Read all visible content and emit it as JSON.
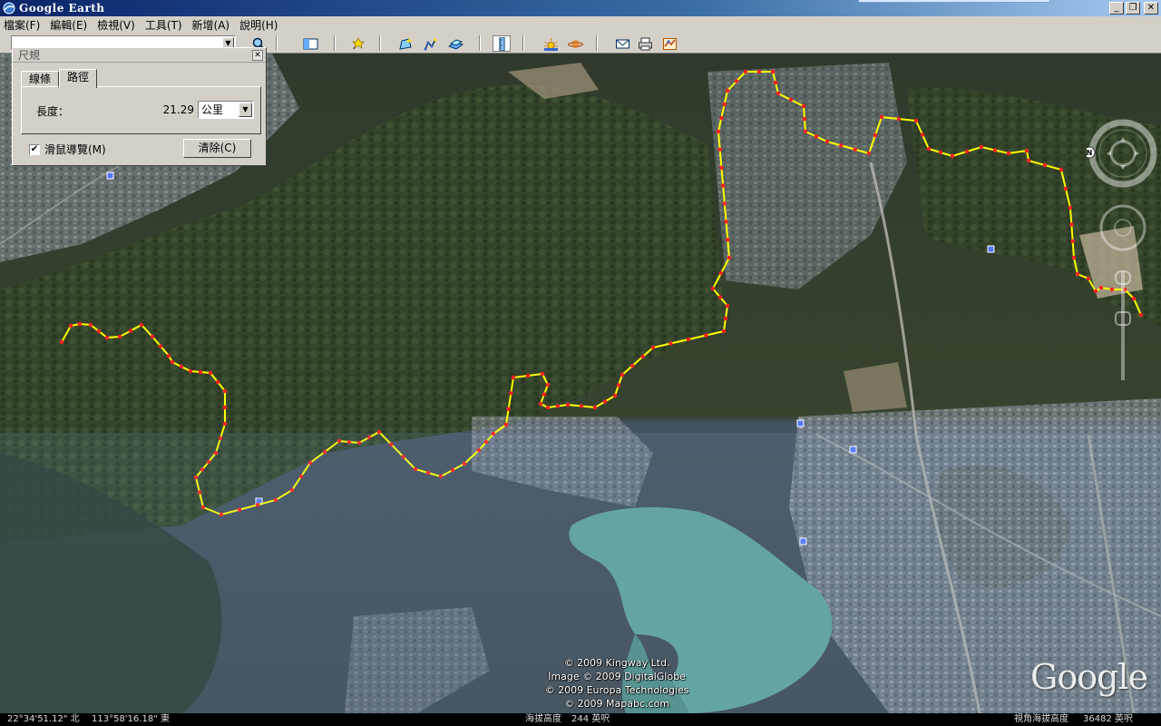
{
  "window": {
    "title": "Google Earth",
    "btn_minimize": "_",
    "btn_restore": "❐",
    "btn_close": "✕"
  },
  "menu": [
    "檔案(F)",
    "編輯(E)",
    "檢視(V)",
    "工具(T)",
    "新增(A)",
    "說明(H)"
  ],
  "toolbar": {
    "search_value": "",
    "icons": [
      "sidebar-toggle-icon",
      "placemark-icon",
      "polygon-icon",
      "path-icon",
      "image-overlay-icon",
      "ruler-icon",
      "sun-icon",
      "planet-icon",
      "email-icon",
      "print-icon",
      "maps-icon"
    ]
  },
  "ruler_dialog": {
    "title": "尺規",
    "tabs": [
      "線條",
      "路徑"
    ],
    "active_tab": "路徑",
    "length_label": "長度：",
    "length_value": "21.29",
    "unit": "公里",
    "mouse_nav_label": "滑鼠導覽(M)",
    "mouse_nav_checked": true,
    "clear_label": "清除(C)"
  },
  "map": {
    "credits": [
      "© 2009 Kingway Ltd.",
      "Image © 2009 DigitalGlobe",
      "© 2009 Europa Technologies",
      "© 2009 Mapabc.com"
    ],
    "brand": "Google",
    "compass_letter": "N",
    "route_color": "#ffff00",
    "vertex_color": "#ff2020"
  },
  "statusbar": {
    "latitude": "22°34'51.12\" 北",
    "longitude": "113°58'16.18\" 東",
    "elevation_label": "海拔高度",
    "elevation_value": "244 英呎",
    "eye_alt_label": "視角海拔高度",
    "eye_alt_value": "36482 英呎"
  }
}
